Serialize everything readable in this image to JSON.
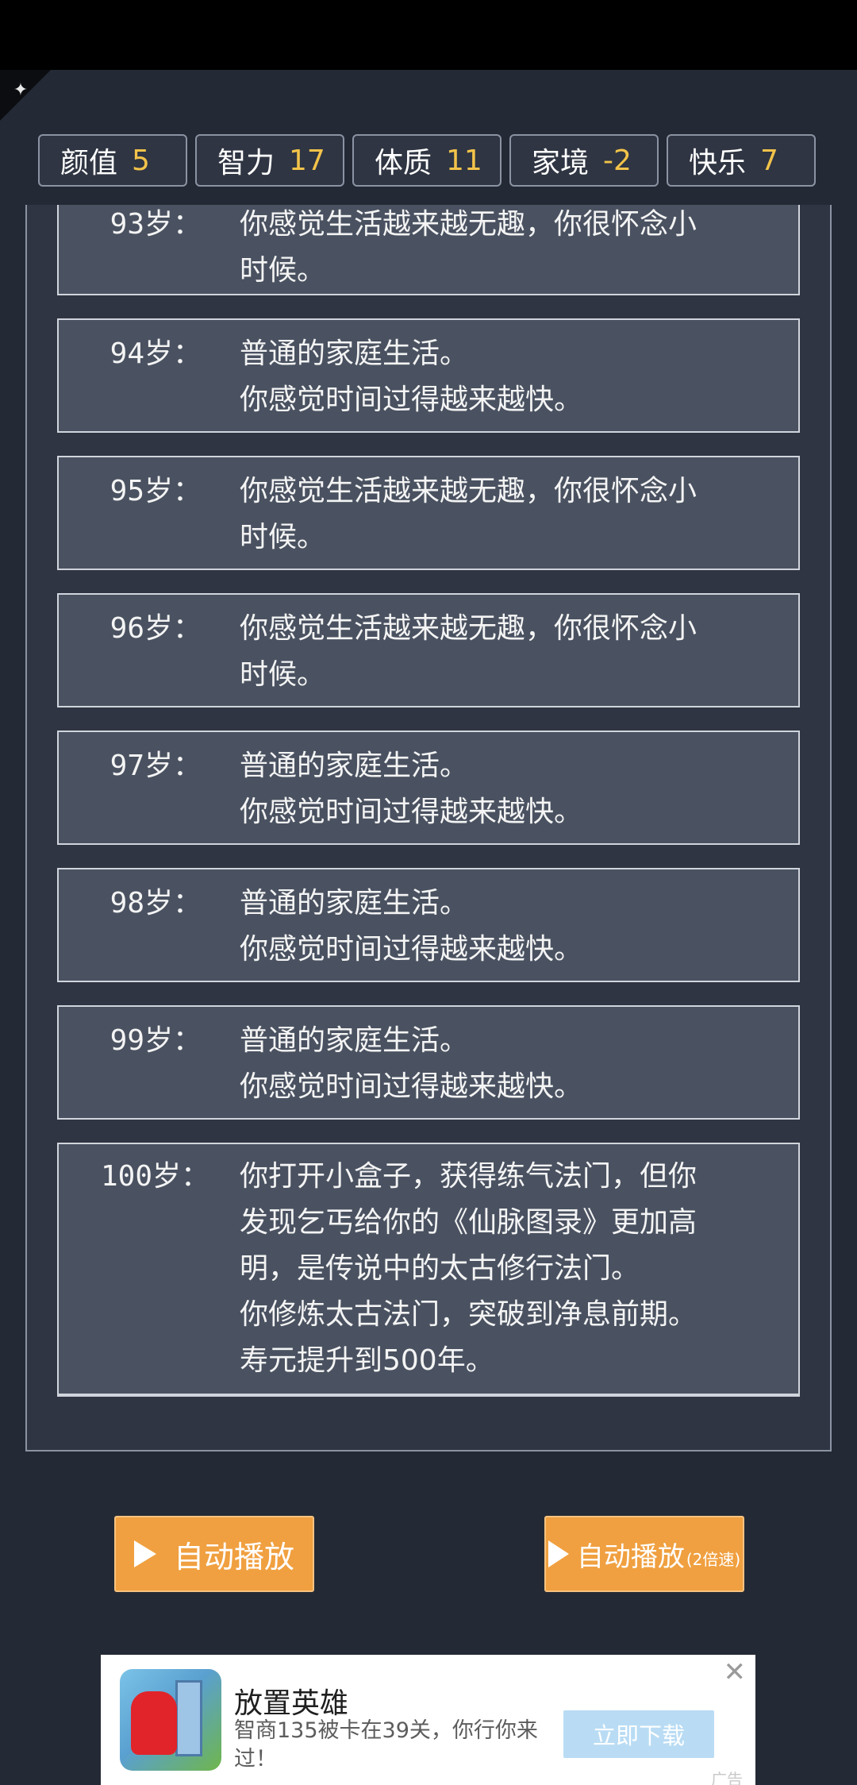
{
  "stats": [
    {
      "label": "颜值",
      "value": "5"
    },
    {
      "label": "智力",
      "value": "17"
    },
    {
      "label": "体质",
      "value": "11"
    },
    {
      "label": "家境",
      "value": "-2"
    },
    {
      "label": "快乐",
      "value": "7"
    }
  ],
  "log": [
    {
      "age": "93岁：",
      "lines": [
        "你感觉生活越来越无趣，你很怀念小",
        "时候。"
      ]
    },
    {
      "age": "94岁：",
      "lines": [
        "普通的家庭生活。",
        "你感觉时间过得越来越快。"
      ]
    },
    {
      "age": "95岁：",
      "lines": [
        "你感觉生活越来越无趣，你很怀念小",
        "时候。"
      ]
    },
    {
      "age": "96岁：",
      "lines": [
        "你感觉生活越来越无趣，你很怀念小",
        "时候。"
      ]
    },
    {
      "age": "97岁：",
      "lines": [
        "普通的家庭生活。",
        "你感觉时间过得越来越快。"
      ]
    },
    {
      "age": "98岁：",
      "lines": [
        "普通的家庭生活。",
        "你感觉时间过得越来越快。"
      ]
    },
    {
      "age": "99岁：",
      "lines": [
        "普通的家庭生活。",
        "你感觉时间过得越来越快。"
      ]
    },
    {
      "age": "100岁：",
      "lines": [
        "你打开小盒子，获得练气法门，但你",
        "发现乞丐给你的《仙脉图录》更加高",
        "明，是传说中的太古修行法门。",
        "你修炼太古法门，突破到净息前期。",
        "寿元提升到500年。"
      ]
    }
  ],
  "buttons": {
    "autoplay": "自动播放",
    "autoplay_fast": "自动播放",
    "autoplay_fast_sub": "(2倍速)"
  },
  "ad": {
    "title": "放置英雄",
    "desc": "智商135被卡在39关，你行你来过！",
    "cta": "立即下载",
    "close": "✕",
    "tag": "广告"
  }
}
